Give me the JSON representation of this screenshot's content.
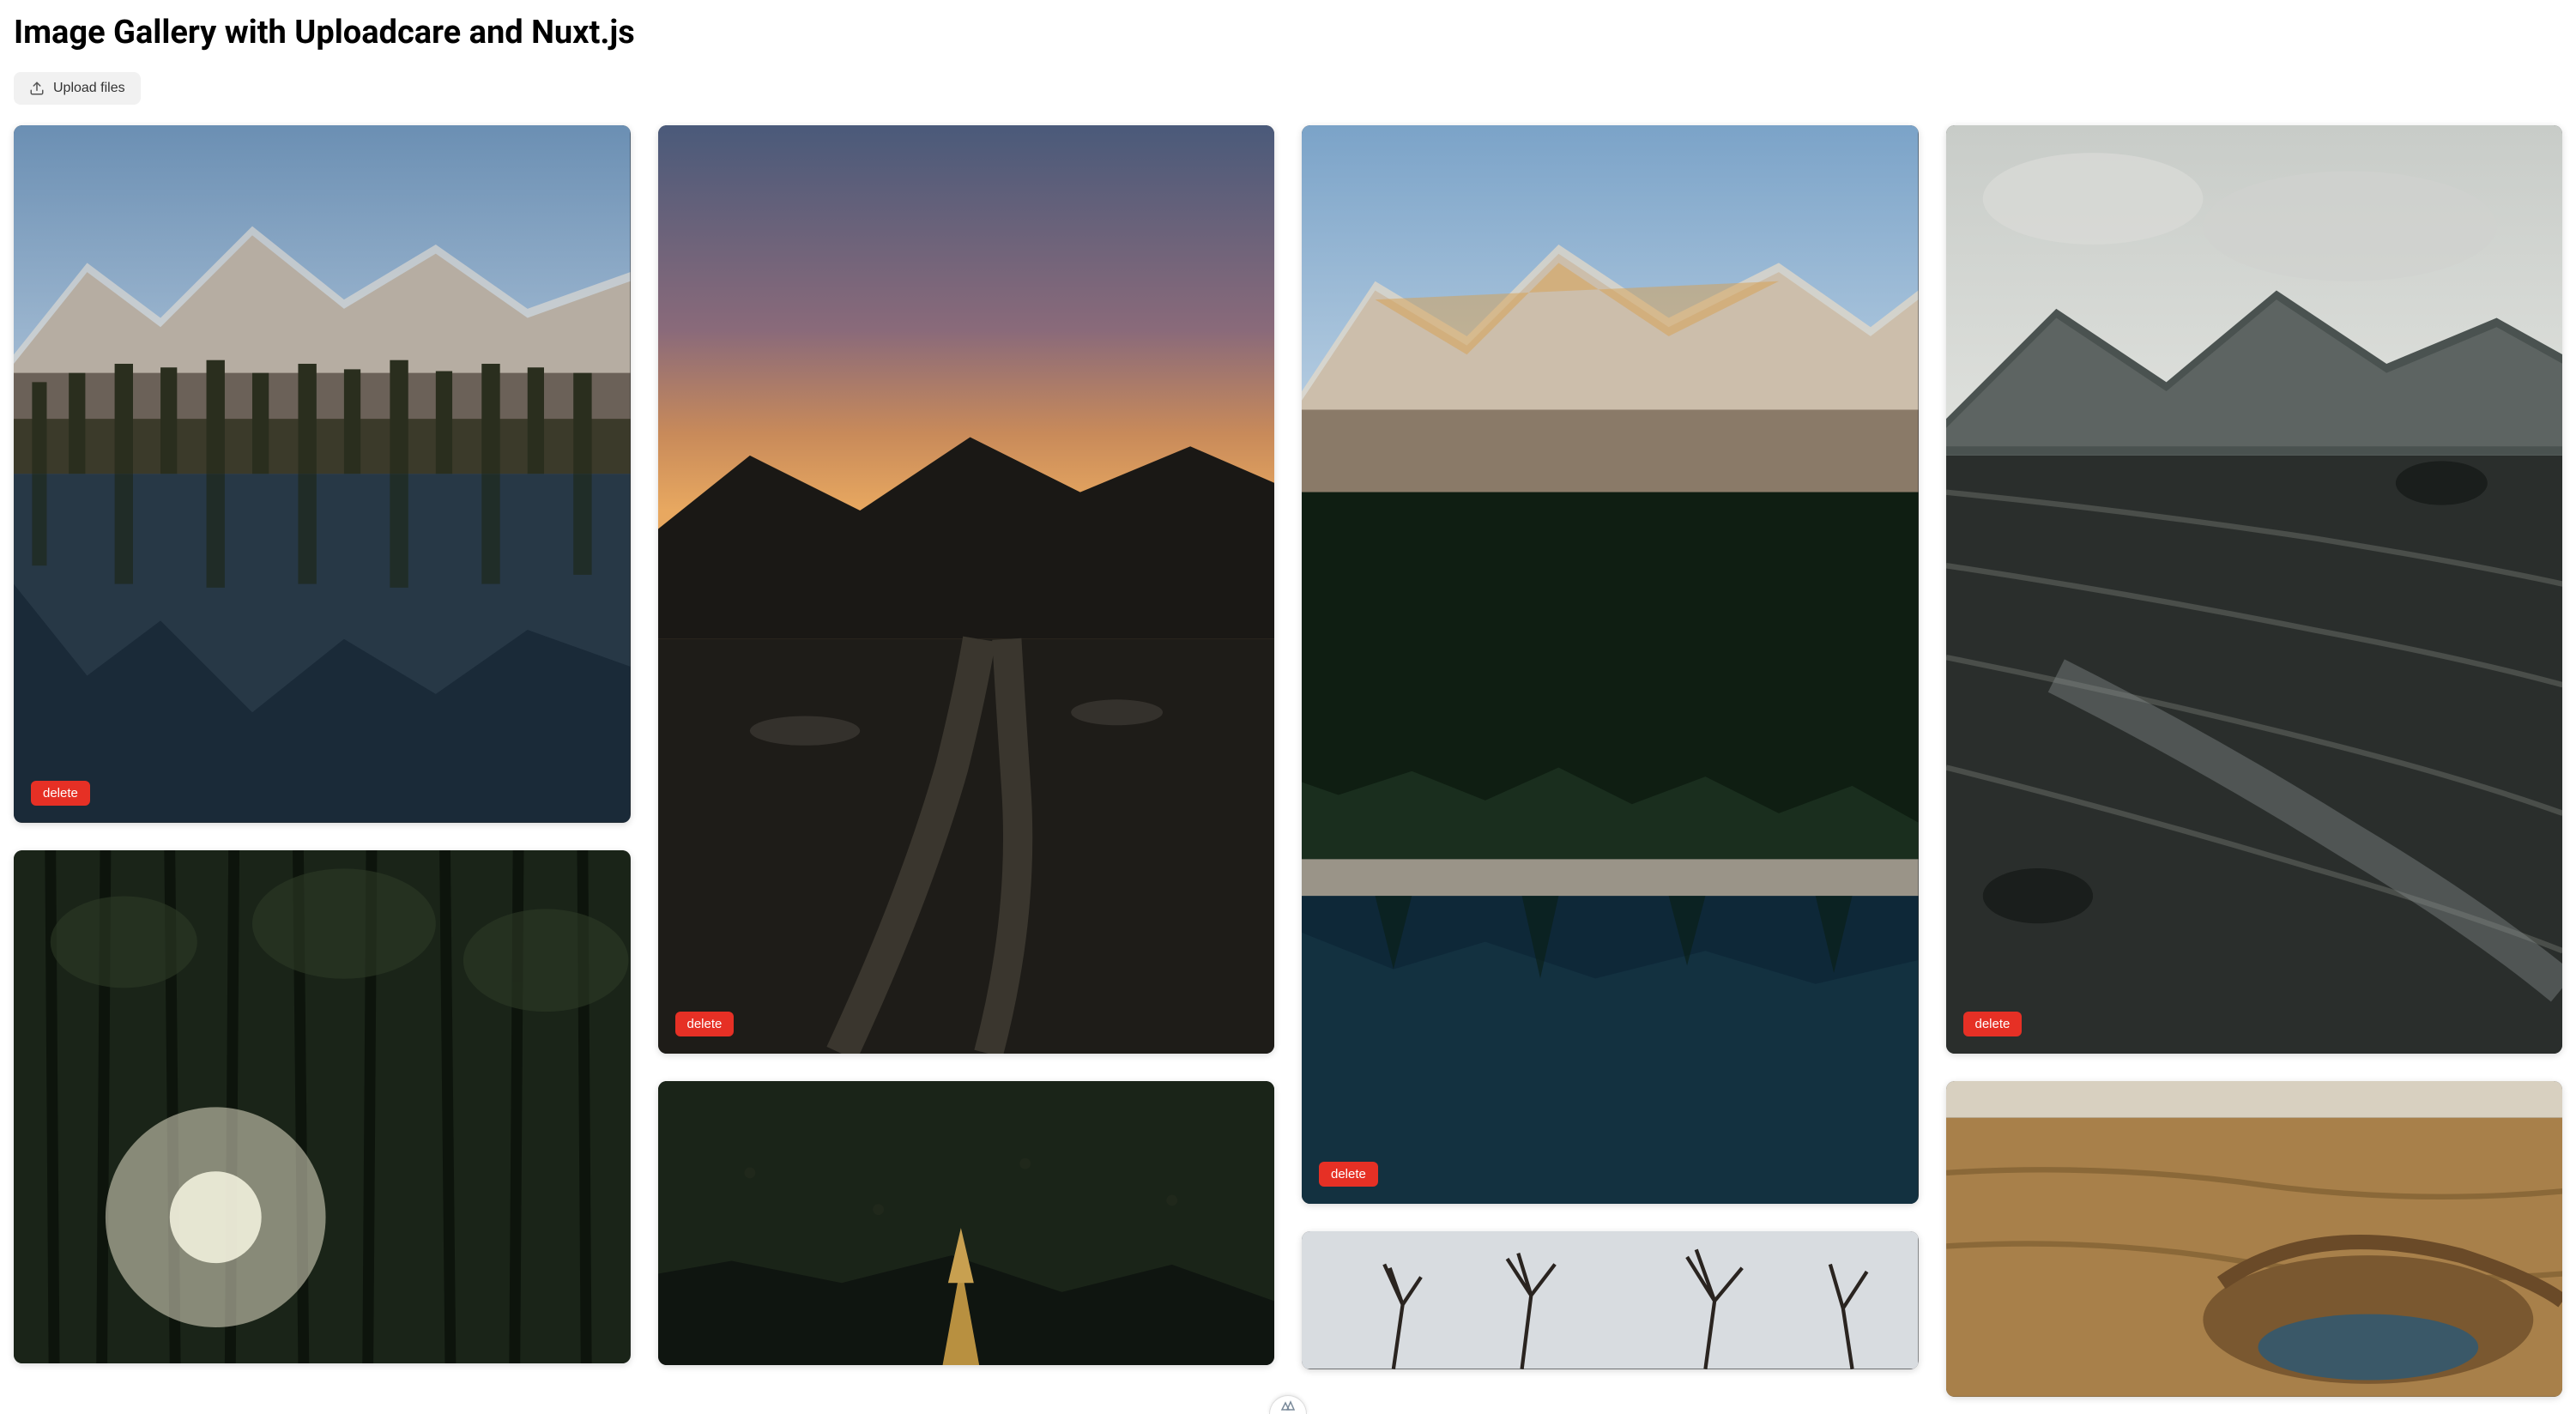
{
  "page": {
    "title": "Image Gallery with Uploadcare and Nuxt.js"
  },
  "upload_button": {
    "label": "Upload files"
  },
  "delete_button": {
    "label": "delete"
  },
  "columns": [
    {
      "items": [
        {
          "aspect": 1.13,
          "show_delete": true
        },
        {
          "aspect": 0.83,
          "show_delete": false
        }
      ]
    },
    {
      "items": [
        {
          "aspect": 1.51,
          "show_delete": true
        },
        {
          "aspect": 0.46,
          "show_delete": false
        }
      ]
    },
    {
      "items": [
        {
          "aspect": 1.75,
          "show_delete": true
        },
        {
          "aspect": 0.22,
          "show_delete": false
        }
      ]
    },
    {
      "items": [
        {
          "aspect": 1.51,
          "show_delete": true
        },
        {
          "aspect": 0.51,
          "show_delete": false
        }
      ]
    }
  ]
}
